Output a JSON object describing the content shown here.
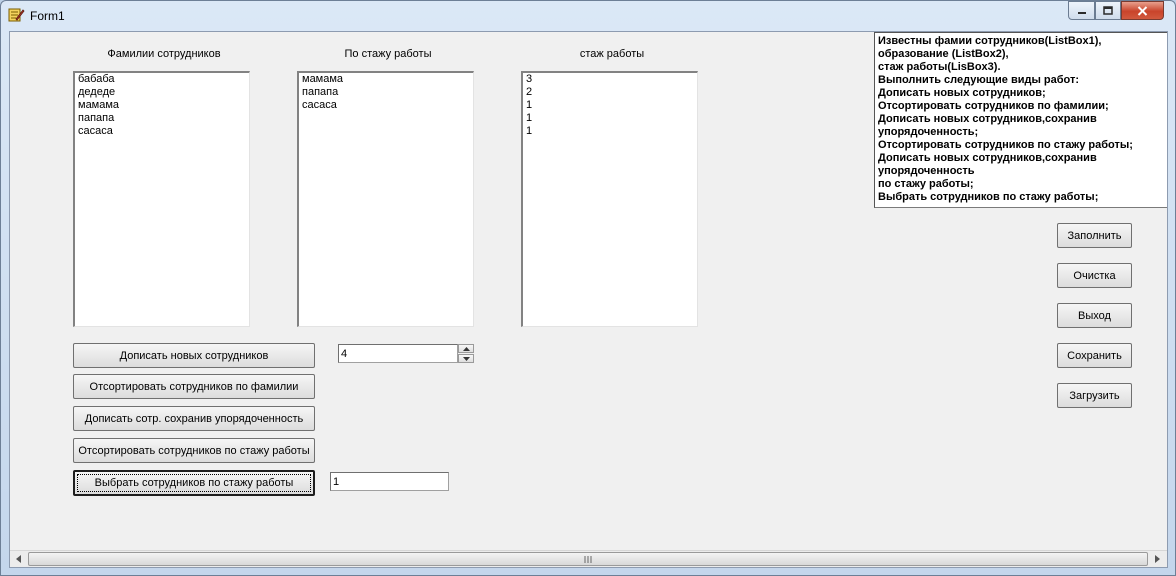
{
  "window": {
    "title": "Form1"
  },
  "labels": {
    "surnames": "Фамилии сотрудников",
    "by_experience": "По стажу работы",
    "experience": "стаж работы"
  },
  "lists": {
    "surnames": [
      "бабаба",
      "дедеде",
      "мамама",
      "папапа",
      "сасаса"
    ],
    "by_experience": [
      "мамама",
      "папапа",
      "сасаса"
    ],
    "experience": [
      "3",
      "2",
      "1",
      "1",
      "1"
    ]
  },
  "memo": {
    "lines": [
      "Известны фамии сотрудников(ListBox1),",
      "образование (ListBox2),",
      "стаж работы(LisBox3).",
      "Выполнить следующие виды работ:",
      "Дописать новых сотрудников;",
      "Отсортировать сотрудников по фамилии;",
      "Дописать новых сотрудников,сохранив",
      "упорядоченность;",
      "Отсортировать сотрудников по стажу работы;",
      "Дописать новых сотрудников,сохранив",
      "упорядоченность",
      "по стажу работы;",
      "Выбрать сотрудников по стажу работы;"
    ]
  },
  "actions": {
    "add_new": "Дописать новых сотрудников",
    "sort_surname": "Отсортировать сотрудников по фамилии",
    "add_keep_order": "Дописать сотр. сохранив упорядоченность",
    "sort_experience": "Отсортировать сотрудников по стажу работы",
    "select_experience": "Выбрать сотрудников по стажу работы"
  },
  "inputs": {
    "count_value": "4",
    "experience_filter_value": "1"
  },
  "side_buttons": {
    "fill": "Заполнить",
    "clear": "Очистка",
    "exit": "Выход",
    "save": "Сохранить",
    "load": "Загрузить"
  },
  "icons": {
    "app": "delphi-app-icon",
    "minimize": "minimize-icon",
    "maximize": "maximize-icon",
    "close": "close-icon"
  }
}
